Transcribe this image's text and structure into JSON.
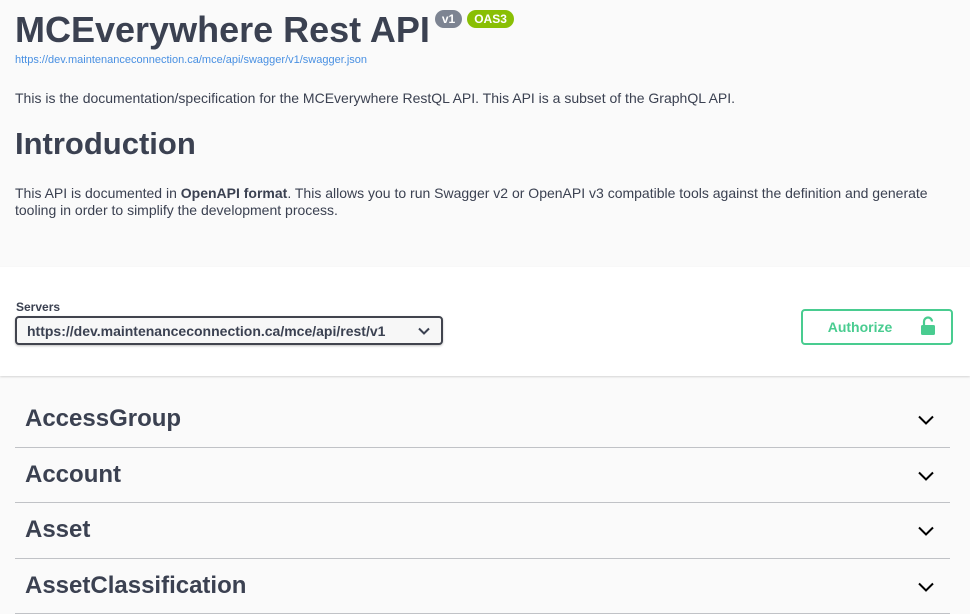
{
  "info": {
    "title": "MCEverywhere Rest API",
    "version_badge": "v1",
    "oas_badge": "OAS3",
    "spec_url": "https://dev.maintenanceconnection.ca/mce/api/swagger/v1/swagger.json",
    "description": "This is the documentation/specification for the MCEverywhere RestQL API. This API is a subset of the GraphQL API.",
    "intro_heading": "Introduction",
    "intro_text_before": "This API is documented in ",
    "intro_text_bold": "OpenAPI format",
    "intro_text_after": ". This allows you to run Swagger v2 or OpenAPI v3 compatible tools against the definition and generate tooling in order to simplify the development process."
  },
  "servers": {
    "label": "Servers",
    "selected": "https://dev.maintenanceconnection.ca/mce/api/rest/v1"
  },
  "authorize": {
    "label": "Authorize"
  },
  "tags": [
    {
      "name": "AccessGroup"
    },
    {
      "name": "Account"
    },
    {
      "name": "Asset"
    },
    {
      "name": "AssetClassification"
    }
  ],
  "colors": {
    "accent_green": "#49cc90",
    "link_blue": "#4990e2",
    "oas_green": "#89bf04",
    "version_gray": "#7d8492"
  }
}
